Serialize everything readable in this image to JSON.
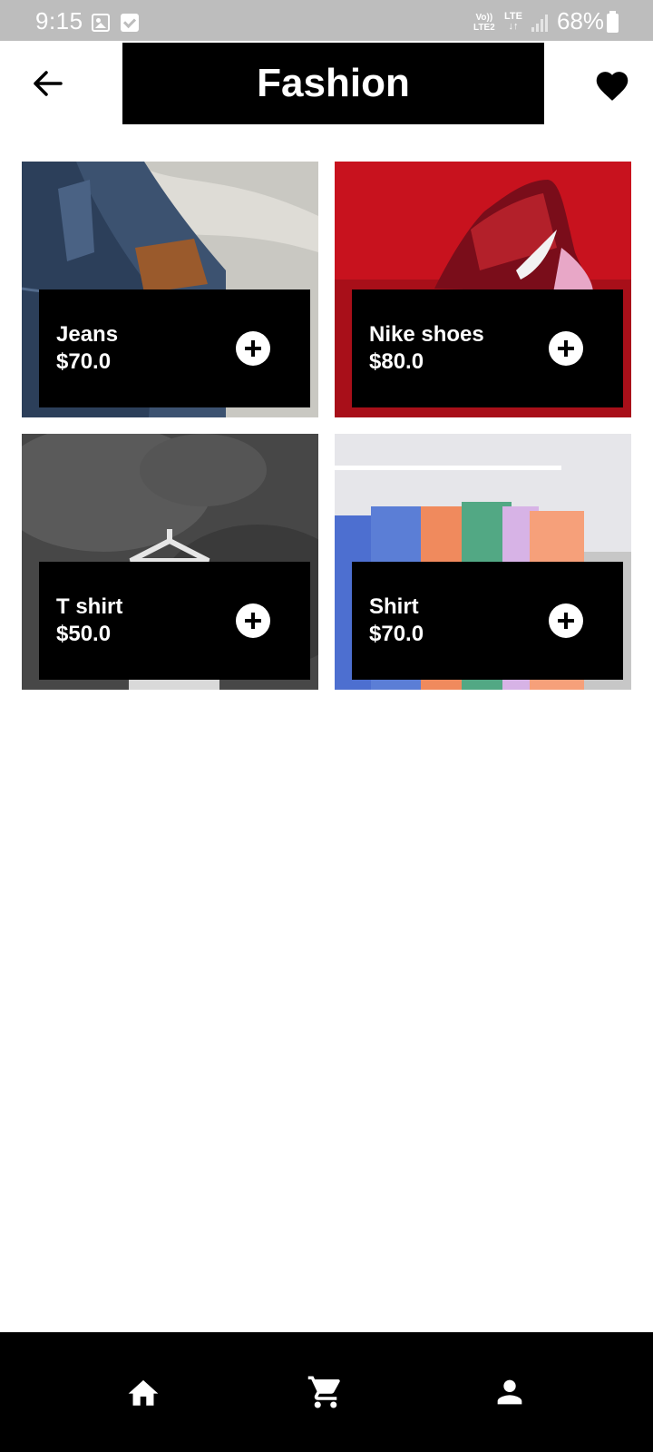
{
  "status_bar": {
    "time": "9:15",
    "network_top": "Vo))",
    "network_bottom": "LTE2",
    "lte_label": "LTE",
    "lte_arrows": "↓↑",
    "battery": "68%"
  },
  "header": {
    "title": "Fashion",
    "back_icon": "arrow-left-icon",
    "favorite_icon": "heart-icon"
  },
  "products": [
    {
      "name": "Jeans",
      "price": "$70.0",
      "image": "denim-jeans-photo"
    },
    {
      "name": "Nike shoes",
      "price": "$80.0",
      "image": "red-sneaker-photo"
    },
    {
      "name": "T shirt",
      "price": "$50.0",
      "image": "tshirt-on-hanger-photo"
    },
    {
      "name": "Shirt",
      "price": "$70.0",
      "image": "shirts-on-rack-photo"
    }
  ],
  "bottom_nav": {
    "items": [
      {
        "icon": "home-icon"
      },
      {
        "icon": "cart-icon"
      },
      {
        "icon": "person-icon"
      }
    ]
  },
  "colors": {
    "status_bar": "#bdbdbd",
    "primary": "#000000",
    "background": "#ffffff",
    "on_primary": "#ffffff"
  }
}
